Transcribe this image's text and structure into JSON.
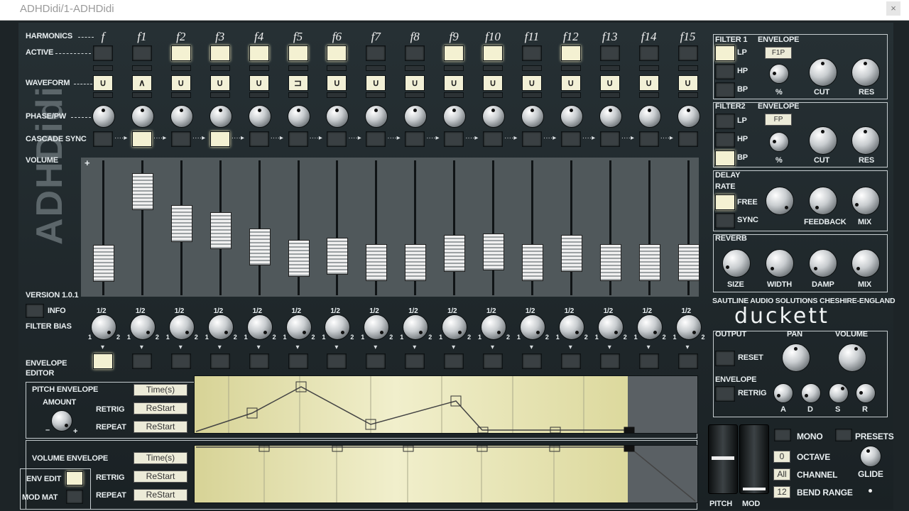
{
  "window": {
    "title": "ADHDidi/1-ADHDidi",
    "close": "×"
  },
  "side_logo": "ADHDidi",
  "version": "VERSION 1.0.1",
  "rows": {
    "harmonics": "HARMONICS",
    "active": "ACTIVE",
    "waveform": "WAVEFORM",
    "phase": "PHASE/PW",
    "cascade": "CASCADE SYNC",
    "volume": "VOLUME",
    "info": "INFO",
    "filter_bias": "FILTER BIAS",
    "envelope_editor_1": "ENVELOPE",
    "envelope_editor_2": "EDITOR",
    "plus": "+"
  },
  "harmonics": [
    {
      "label": "f",
      "active": false,
      "wave": "sine",
      "cascade": false,
      "vol": 0.14
    },
    {
      "label": "f1",
      "active": false,
      "wave": "triangle",
      "cascade": true,
      "vol": 0.88
    },
    {
      "label": "f2",
      "active": true,
      "wave": "sine",
      "cascade": false,
      "vol": 0.55
    },
    {
      "label": "f3",
      "active": true,
      "wave": "sine",
      "cascade": true,
      "vol": 0.48
    },
    {
      "label": "f4",
      "active": true,
      "wave": "sine",
      "cascade": false,
      "vol": 0.31
    },
    {
      "label": "f5",
      "active": true,
      "wave": "square",
      "cascade": false,
      "vol": 0.19
    },
    {
      "label": "f6",
      "active": true,
      "wave": "sine",
      "cascade": false,
      "vol": 0.21
    },
    {
      "label": "f7",
      "active": false,
      "wave": "sine",
      "cascade": false,
      "vol": 0.15
    },
    {
      "label": "f8",
      "active": false,
      "wave": "sine",
      "cascade": false,
      "vol": 0.15
    },
    {
      "label": "f9",
      "active": true,
      "wave": "sine",
      "cascade": false,
      "vol": 0.24
    },
    {
      "label": "f10",
      "active": true,
      "wave": "sine",
      "cascade": false,
      "vol": 0.26
    },
    {
      "label": "f11",
      "active": false,
      "wave": "sine",
      "cascade": false,
      "vol": 0.15
    },
    {
      "label": "f12",
      "active": true,
      "wave": "sine",
      "cascade": false,
      "vol": 0.24
    },
    {
      "label": "f13",
      "active": false,
      "wave": "sine",
      "cascade": false,
      "vol": 0.15
    },
    {
      "label": "f14",
      "active": false,
      "wave": "sine",
      "cascade": false,
      "vol": 0.15
    },
    {
      "label": "f15",
      "active": false,
      "wave": "sine",
      "cascade": false,
      "vol": 0.15
    }
  ],
  "bias_labels": {
    "half": "1/2",
    "one": "1",
    "two": "2"
  },
  "filter1": {
    "title": "FILTER 1",
    "envelope": "ENVELOPE",
    "env_value": "F1P",
    "lp": "LP",
    "hp": "HP",
    "bp": "BP",
    "percent": "%",
    "cut": "CUT",
    "res": "RES"
  },
  "filter2": {
    "title": "FILTER2",
    "envelope": "ENVELOPE",
    "env_value": "FP",
    "lp": "LP",
    "hp": "HP",
    "bp": "BP",
    "percent": "%",
    "cut": "CUT",
    "res": "RES"
  },
  "delay": {
    "title": "DELAY",
    "rate": "RATE",
    "free": "FREE",
    "sync": "SYNC",
    "feedback": "FEEDBACK",
    "mix": "MIX"
  },
  "reverb": {
    "title": "REVERB",
    "size": "SIZE",
    "width": "WIDTH",
    "damp": "DAMP",
    "mix": "MIX"
  },
  "company": "SAUTLINE AUDIO SOLUTIONS  CHESHIRE-ENGLAND",
  "brand": "duckett",
  "output": {
    "title": "OUTPUT",
    "reset": "RESET",
    "pan": "PAN",
    "volume": "VOLUME"
  },
  "amp_env": {
    "title": "ENVELOPE",
    "retrig": "RETRIG",
    "a": "A",
    "d": "D",
    "s": "S",
    "r": "R"
  },
  "pitch_env": {
    "title": "PITCH ENVELOPE",
    "amount": "AMOUNT",
    "retrig": "RETRIG",
    "repeat": "REPEAT",
    "time": "Time(s)",
    "restart1": "ReStart",
    "restart2": "ReStart",
    "minus": "–",
    "plus": "+"
  },
  "volume_env": {
    "title": "VOLUME ENVELOPE",
    "retrig": "RETRIG",
    "repeat": "REPEAT",
    "time": "Time(s)",
    "restart1": "ReStart",
    "restart2": "ReStart"
  },
  "bottom_left": {
    "env_edit": "ENV EDIT",
    "mod_mat": "MOD MAT"
  },
  "wheels": {
    "pitch": "PITCH",
    "mod": "MOD"
  },
  "mono": "MONO",
  "presets": "PRESETS",
  "octave": {
    "label": "OCTAVE",
    "value": "0"
  },
  "channel": {
    "label": "CHANNEL",
    "value": "All"
  },
  "glide": "GLIDE",
  "bend": {
    "label": "BEND RANGE",
    "value": "12"
  },
  "colors": {
    "lit": "#f4f1d2",
    "panel": "#1d2427",
    "env": "#e6e3b4"
  }
}
